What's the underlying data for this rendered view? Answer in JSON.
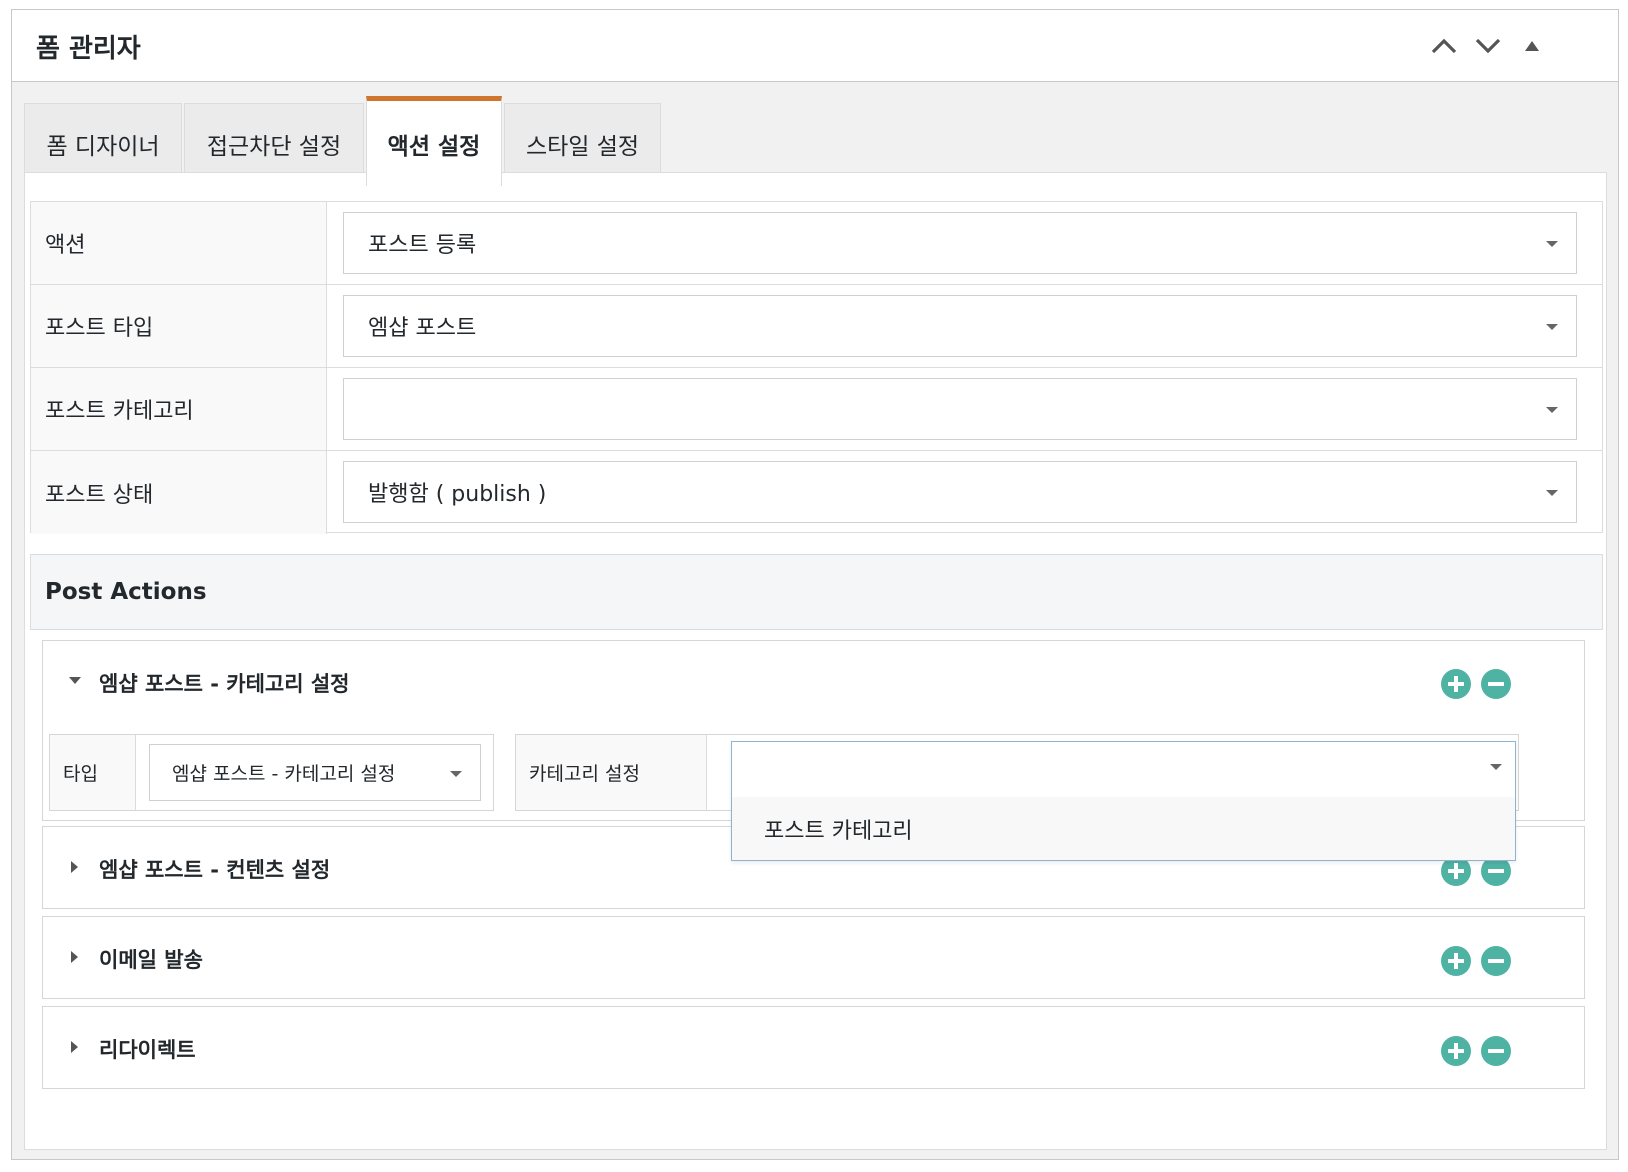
{
  "panel": {
    "title": "폼 관리자"
  },
  "header_controls": [
    {
      "icon": "chevron-up-icon"
    },
    {
      "icon": "chevron-down-icon"
    },
    {
      "icon": "triangle-up-icon"
    }
  ],
  "tabs": [
    {
      "label": "폼 디자이너",
      "active": false
    },
    {
      "label": "접근차단 설정",
      "active": false
    },
    {
      "label": "액션 설정",
      "active": true
    },
    {
      "label": "스타일 설정",
      "active": false
    }
  ],
  "settings": [
    {
      "label": "액션",
      "value": "포스트 등록"
    },
    {
      "label": "포스트 타입",
      "value": "엠샵 포스트"
    },
    {
      "label": "포스트 카테고리",
      "value": ""
    },
    {
      "label": "포스트 상태",
      "value": "발행함 ( publish )"
    }
  ],
  "post_actions": {
    "title": "Post Actions",
    "items": [
      {
        "title": "엠샵 포스트 - 카테고리 설정",
        "expanded": true,
        "fields": {
          "type_label": "타입",
          "type_value": "엠샵 포스트 - 카테고리 설정",
          "category_label": "카테고리 설정",
          "category_value": ""
        }
      },
      {
        "title": "엠샵 포스트 - 컨텐츠 설정",
        "expanded": false
      },
      {
        "title": "이메일 발송",
        "expanded": false
      },
      {
        "title": "리다이렉트",
        "expanded": false
      }
    ]
  },
  "dropdown": {
    "options": [
      "포스트 카테고리"
    ]
  },
  "colors": {
    "accent_tab": "#d0752e",
    "action_button": "#4fb3a4",
    "dropdown_border": "#8db5d1"
  }
}
